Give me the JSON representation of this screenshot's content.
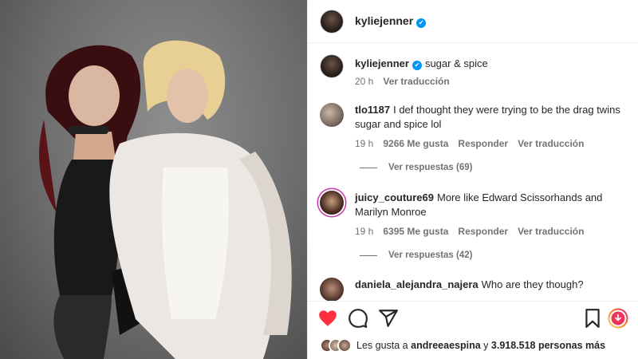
{
  "post": {
    "author": "kyliejenner",
    "caption": "sugar & spice",
    "time": "20 h",
    "translate": "Ver traducción"
  },
  "comments": [
    {
      "user": "tlo1187",
      "text": "I def thought they were trying to be the drag twins sugar and spice lol",
      "time": "19 h",
      "likes": "9266 Me gusta",
      "reply": "Responder",
      "translate": "Ver traducción",
      "view_replies": "Ver respuestas (69)"
    },
    {
      "user": "juicy_couture69",
      "text": "More like Edward Scissorhands and Marilyn Monroe",
      "time": "19 h",
      "likes": "6395 Me gusta",
      "reply": "Responder",
      "translate": "Ver traducción",
      "view_replies": "Ver respuestas (42)"
    },
    {
      "user": "daniela_alejandra_najera",
      "text": "Who are they though?"
    }
  ],
  "likes_line": {
    "prefix": "Les gusta a",
    "user": "andreeaespina",
    "connector": "y",
    "count": "3.918.518 personas más"
  },
  "icons": [
    "heart-icon",
    "comment-icon",
    "share-icon",
    "bookmark-icon",
    "story-ring-icon"
  ],
  "colors": {
    "heart": "#ff3040",
    "verified": "#0095f6",
    "secondary_text": "#737373"
  }
}
